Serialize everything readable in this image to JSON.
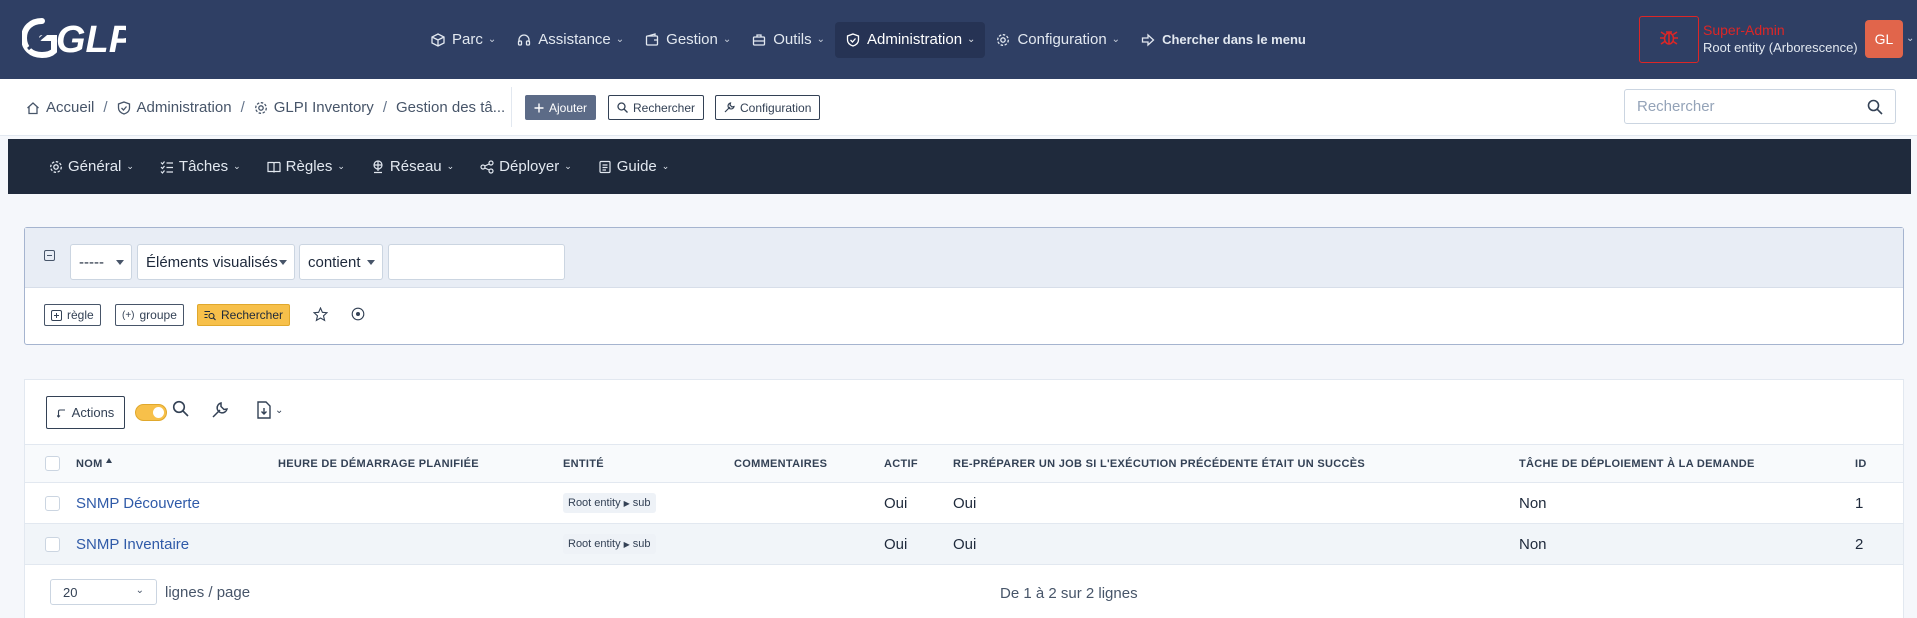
{
  "header": {
    "logo_text": "GLPI",
    "nav": [
      {
        "label": "Parc",
        "icon": "cube-icon"
      },
      {
        "label": "Assistance",
        "icon": "headset-icon"
      },
      {
        "label": "Gestion",
        "icon": "wallet-icon"
      },
      {
        "label": "Outils",
        "icon": "briefcase-icon"
      },
      {
        "label": "Administration",
        "icon": "shield-icon",
        "active": true
      },
      {
        "label": "Configuration",
        "icon": "gear-icon"
      }
    ],
    "menu_search_label": "Chercher dans le menu",
    "user": {
      "role": "Super-Admin",
      "entity": "Root entity (Arborescence)",
      "initials": "GL",
      "debug_icon": "bug-icon"
    }
  },
  "breadcrumb": {
    "items": [
      "Accueil",
      "Administration",
      "GLPI Inventory",
      "Gestion des tâ..."
    ],
    "separator": "/"
  },
  "toolbar": {
    "add_label": "Ajouter",
    "search_label": "Rechercher",
    "config_label": "Configuration"
  },
  "global_search": {
    "placeholder": "Rechercher"
  },
  "subnav": [
    "Général",
    "Tâches",
    "Règles",
    "Réseau",
    "Déployer",
    "Guide"
  ],
  "criteria": {
    "field_select": "-----",
    "item_select": "Éléments visualisés",
    "operator_select": "contient",
    "value": "",
    "rule_button": "règle",
    "group_button": "groupe",
    "search_button": "Rechercher"
  },
  "results": {
    "actions_label": "Actions",
    "columns": [
      "NOM",
      "HEURE DE DÉMARRAGE PLANIFIÉE",
      "ENTITÉ",
      "COMMENTAIRES",
      "ACTIF",
      "RE-PRÉPARER UN JOB SI L'EXÉCUTION PRÉCÉDENTE ÉTAIT UN SUCCÈS",
      "TÂCHE DE DÉPLOIEMENT À LA DEMANDE",
      "ID"
    ],
    "rows": [
      {
        "name": "SNMP Découverte",
        "start": "",
        "entity_root": "Root entity",
        "entity_sub": "sub",
        "comments": "",
        "active": "Oui",
        "reprepare": "Oui",
        "ondemand": "Non",
        "id": "1"
      },
      {
        "name": "SNMP Inventaire",
        "start": "",
        "entity_root": "Root entity",
        "entity_sub": "sub",
        "comments": "",
        "active": "Oui",
        "reprepare": "Oui",
        "ondemand": "Non",
        "id": "2"
      }
    ],
    "page_size": "20",
    "page_size_label": "lignes / page",
    "count_label": "De 1 à 2 sur 2 lignes"
  },
  "colors": {
    "header_bg": "#2f3f64",
    "subnav_bg": "#1f2a3c",
    "accent": "#f7c04a",
    "danger": "#dc2626",
    "avatar": "#e1654b",
    "link": "#2f5aa8"
  }
}
